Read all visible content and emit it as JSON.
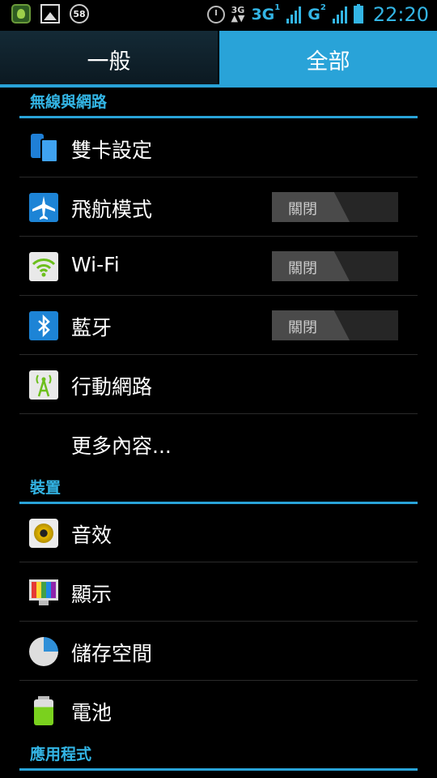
{
  "status_bar": {
    "notification_badge": "58",
    "net_small": "3G",
    "net_1": "3G",
    "sim_1": "1",
    "net_2": "G",
    "sim_2": "2",
    "time": "22:20",
    "icons": [
      "bug-app-icon",
      "gallery-icon",
      "badge-icon",
      "alarm-icon",
      "signal-icon",
      "battery-icon"
    ]
  },
  "tabs": {
    "general": "一般",
    "all": "全部",
    "selected": "全部"
  },
  "sections": {
    "wireless": {
      "title": "無線與網路",
      "items": [
        {
          "label": "雙卡設定",
          "icon": "dual-sim-icon"
        },
        {
          "label": "飛航模式",
          "icon": "airplane-icon",
          "toggle": "關閉"
        },
        {
          "label": "Wi-Fi",
          "icon": "wifi-icon",
          "toggle": "關閉"
        },
        {
          "label": "藍牙",
          "icon": "bluetooth-icon",
          "toggle": "關閉"
        },
        {
          "label": "行動網路",
          "icon": "mobile-network-icon"
        },
        {
          "label": "更多內容..."
        }
      ]
    },
    "device": {
      "title": "裝置",
      "items": [
        {
          "label": "音效",
          "icon": "sound-icon"
        },
        {
          "label": "顯示",
          "icon": "display-icon"
        },
        {
          "label": "儲存空間",
          "icon": "storage-icon"
        },
        {
          "label": "電池",
          "icon": "battery-icon"
        }
      ]
    },
    "apps": {
      "title": "應用程式"
    }
  },
  "colors": {
    "accent": "#33b5e5",
    "tab_selected": "#29a3d8",
    "background": "#000000"
  }
}
